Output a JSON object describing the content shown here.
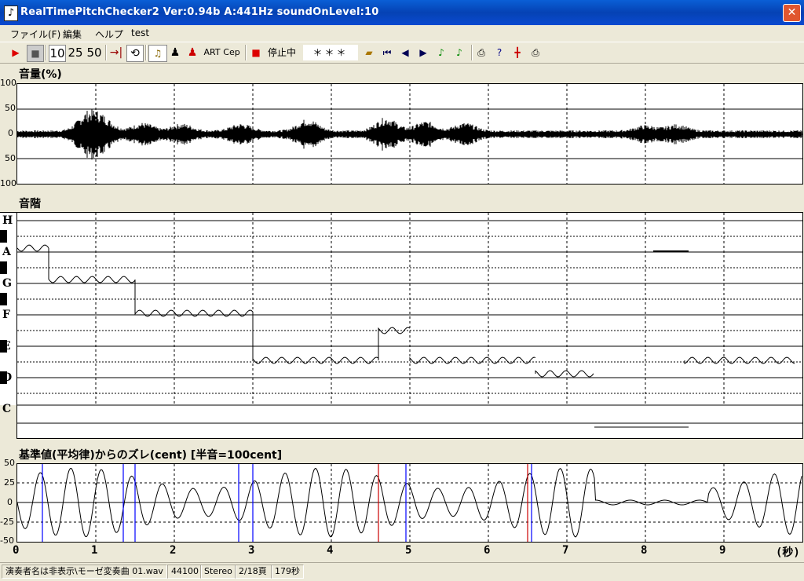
{
  "window": {
    "title": "RealTimePitchChecker2   Ver:0.94b        A:441Hz     soundOnLevel:10",
    "close": "✕",
    "app_icon": "♪"
  },
  "menu": [
    "ファイル(F)",
    "編集",
    "ヘルプ",
    "test"
  ],
  "toolbar": {
    "play": "▶",
    "stop": "■",
    "n10": "10",
    "n25": "25",
    "n50": "50",
    "art": "ART",
    "cep": "Cep",
    "status": "停止中",
    "note": "＊＊＊"
  },
  "panels": {
    "volume": "音量(%)",
    "scale": "音階",
    "deviation": "基準値(平均律)からのズレ(cent) [半音=100cent]"
  },
  "volume_ticks": [
    "100",
    "50",
    "0",
    "50",
    "100"
  ],
  "note_labels": [
    "H",
    "A",
    "G",
    "F",
    "E",
    "D",
    "C"
  ],
  "cent_ticks": [
    "50",
    "25",
    "0",
    "-25",
    "-50"
  ],
  "time_ticks": [
    "0",
    "1",
    "2",
    "3",
    "4",
    "5",
    "6",
    "7",
    "8",
    "9"
  ],
  "time_unit": "(秒)",
  "status": [
    "演奏者名は非表示\\モーゼ変奏曲 01.wav",
    "44100",
    "Stereo",
    "2/18頁",
    "179秒"
  ]
}
